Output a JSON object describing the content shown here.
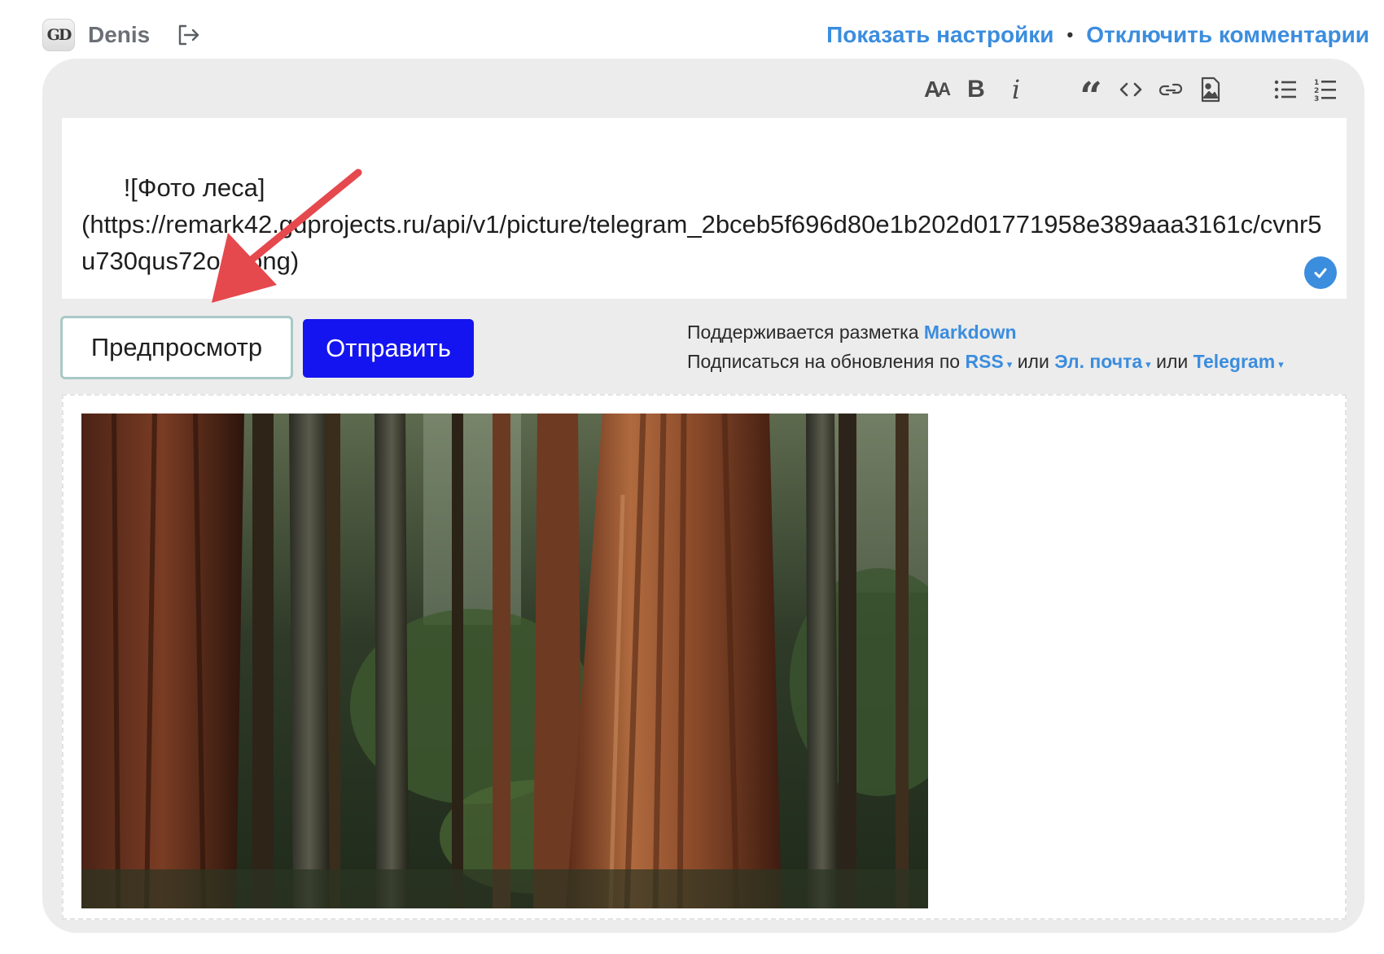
{
  "user": {
    "avatar_text": "GD",
    "name": "Denis",
    "logout_icon": "logout-icon"
  },
  "links": {
    "show_settings": "Показать настройки",
    "separator": "•",
    "disable_comments": "Отключить комментарии"
  },
  "toolbar": {
    "items": [
      {
        "name": "text-size-icon",
        "label": "AA"
      },
      {
        "name": "bold-icon",
        "label": "B"
      },
      {
        "name": "italic-icon",
        "label": "i"
      },
      {
        "name": "quote-icon",
        "label": "“"
      },
      {
        "name": "code-icon",
        "label": ""
      },
      {
        "name": "link-icon",
        "label": ""
      },
      {
        "name": "image-icon",
        "label": ""
      },
      {
        "name": "unordered-list-icon",
        "label": ""
      },
      {
        "name": "ordered-list-icon",
        "label": ""
      }
    ]
  },
  "editor": {
    "value": "![Фото леса]\n(https://remark42.gdprojects.ru/api/v1/picture/telegram_2bceb5f696d80e1b202d01771958e389aaa3161c/cvnr5u730qus72ognpng)",
    "badge_icon": "check-icon"
  },
  "actions": {
    "preview_label": "Предпросмотр",
    "send_label": "Отправить"
  },
  "meta": {
    "markdown_prefix": "Поддерживается разметка",
    "markdown_link": "Markdown",
    "subscribe_prefix": "Подписаться на обновления по",
    "rss": "RSS",
    "or_1": "или",
    "email": "Эл. почта",
    "or_2": "или",
    "telegram": "Telegram",
    "caret": "▾"
  },
  "colors": {
    "accent_link": "#3b8dde",
    "send_button": "#1414f0",
    "panel_bg": "#ececec",
    "annotation_arrow": "#e5484d"
  }
}
